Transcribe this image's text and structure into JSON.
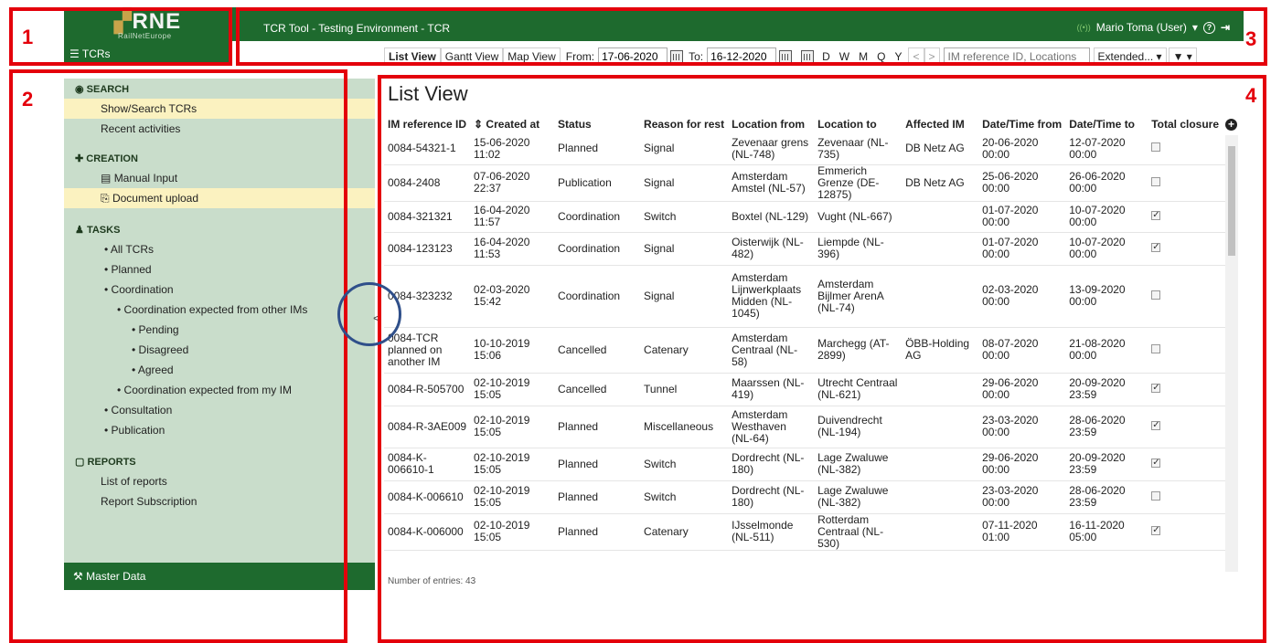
{
  "header": {
    "logo_text": "RNE",
    "logo_subtext": "RailNetEurope",
    "app_title": "TCR Tool - Testing Environment  -  TCR",
    "tcrs_label": "TCRs",
    "user_name": "Mario Toma (User)",
    "signal_glyph": "((•))",
    "help_glyph": "?",
    "logout_glyph": "⇥"
  },
  "toolbar": {
    "list_view": "List View",
    "gantt_view": "Gantt View",
    "map_view": "Map View",
    "from_label": "From:",
    "from_value": "17-06-2020",
    "to_label": "To:",
    "to_value": "16-12-2020",
    "periods": [
      "D",
      "W",
      "M",
      "Q",
      "Y"
    ],
    "prev": "<",
    "next": ">",
    "search_placeholder": "IM reference ID, Locations",
    "extended": "Extended... ▾",
    "filter": "▼ ▾"
  },
  "sidebar": {
    "search_title": "SEARCH",
    "show_search": "Show/Search TCRs",
    "recent": "Recent activities",
    "creation_title": "CREATION",
    "manual_input": "Manual Input",
    "document_upload": "Document upload",
    "tasks_title": "TASKS",
    "all_tcrs": "All TCRs",
    "planned": "Planned",
    "coordination": "Coordination",
    "coord_other": "Coordination expected from other IMs",
    "pending": "Pending",
    "disagreed": "Disagreed",
    "agreed": "Agreed",
    "coord_my": "Coordination expected from my IM",
    "consultation": "Consultation",
    "publication": "Publication",
    "reports_title": "REPORTS",
    "list_reports": "List of reports",
    "report_subscription": "Report Subscription",
    "master_data": "Master Data",
    "collapse_glyph": "<"
  },
  "main": {
    "title": "List View",
    "columns": [
      "IM reference ID",
      "⇕ Created at",
      "Status",
      "Reason for rest",
      "Location from",
      "Location to",
      "Affected IM",
      "Date/Time from",
      "Date/Time to",
      "Total closure"
    ],
    "rows": [
      {
        "id": "0084-54321-1",
        "created": "15-06-2020 11:02",
        "status": "Planned",
        "reason": "Signal",
        "from": "Zevenaar grens (NL-748)",
        "to": "Zevenaar (NL-735)",
        "im": "DB Netz AG",
        "dfrom": "20-06-2020 00:00",
        "dto": "12-07-2020 00:00",
        "closure": false
      },
      {
        "id": "0084-2408",
        "created": "07-06-2020 22:37",
        "status": "Publication",
        "reason": "Signal",
        "from": "Amsterdam Amstel (NL-57)",
        "to": "Emmerich Grenze (DE-12875)",
        "im": "DB Netz AG",
        "dfrom": "25-06-2020 00:00",
        "dto": "26-06-2020 00:00",
        "closure": false
      },
      {
        "id": "0084-321321",
        "created": "16-04-2020 11:57",
        "status": "Coordination",
        "reason": "Switch",
        "from": "Boxtel (NL-129)",
        "to": "Vught (NL-667)",
        "im": "",
        "dfrom": "01-07-2020 00:00",
        "dto": "10-07-2020 00:00",
        "closure": true
      },
      {
        "id": "0084-123123",
        "created": "16-04-2020 11:53",
        "status": "Coordination",
        "reason": "Signal",
        "from": "Oisterwijk (NL-482)",
        "to": "Liempde (NL-396)",
        "im": "",
        "dfrom": "01-07-2020 00:00",
        "dto": "10-07-2020 00:00",
        "closure": true
      },
      {
        "id": "0084-323232",
        "created": "02-03-2020 15:42",
        "status": "Coordination",
        "reason": "Signal",
        "from": "Amsterdam Lijnwerkplaats Midden (NL-1045)",
        "to": "Amsterdam Bijlmer ArenA (NL-74)",
        "im": "",
        "dfrom": "02-03-2020 00:00",
        "dto": "13-09-2020 00:00",
        "closure": false
      },
      {
        "id": "0084-TCR planned on another IM",
        "created": "10-10-2019 15:06",
        "status": "Cancelled",
        "reason": "Catenary",
        "from": "Amsterdam Centraal (NL-58)",
        "to": "Marchegg (AT-2899)",
        "im": "ÖBB-Holding AG",
        "dfrom": "08-07-2020 00:00",
        "dto": "21-08-2020 00:00",
        "closure": false
      },
      {
        "id": "0084-R-505700",
        "created": "02-10-2019 15:05",
        "status": "Cancelled",
        "reason": "Tunnel",
        "from": "Maarssen (NL-419)",
        "to": "Utrecht Centraal (NL-621)",
        "im": "",
        "dfrom": "29-06-2020 00:00",
        "dto": "20-09-2020 23:59",
        "closure": true
      },
      {
        "id": "0084-R-3AE009",
        "created": "02-10-2019 15:05",
        "status": "Planned",
        "reason": "Miscellaneous",
        "from": "Amsterdam Westhaven (NL-64)",
        "to": "Duivendrecht (NL-194)",
        "im": "",
        "dfrom": "23-03-2020 00:00",
        "dto": "28-06-2020 23:59",
        "closure": true
      },
      {
        "id": "0084-K-006610-1",
        "created": "02-10-2019 15:05",
        "status": "Planned",
        "reason": "Switch",
        "from": "Dordrecht (NL-180)",
        "to": "Lage Zwaluwe (NL-382)",
        "im": "",
        "dfrom": "29-06-2020 00:00",
        "dto": "20-09-2020 23:59",
        "closure": true
      },
      {
        "id": "0084-K-006610",
        "created": "02-10-2019 15:05",
        "status": "Planned",
        "reason": "Switch",
        "from": "Dordrecht (NL-180)",
        "to": "Lage Zwaluwe (NL-382)",
        "im": "",
        "dfrom": "23-03-2020 00:00",
        "dto": "28-06-2020 23:59",
        "closure": false
      },
      {
        "id": "0084-K-006000",
        "created": "02-10-2019 15:05",
        "status": "Planned",
        "reason": "Catenary",
        "from": "IJsselmonde (NL-511)",
        "to": "Rotterdam Centraal (NL-530)",
        "im": "",
        "dfrom": "07-11-2020 01:00",
        "dto": "16-11-2020 05:00",
        "closure": true
      }
    ],
    "entries": "Number of entries: 43",
    "add_glyph": "+"
  },
  "annotations": {
    "labels": [
      "1",
      "2",
      "3",
      "4"
    ],
    "color": "#e4000b"
  },
  "colors": {
    "header_green": "#1e6a2e",
    "sidebar_green": "#c9ddcb",
    "highlight_yellow": "#fbf2c0"
  }
}
